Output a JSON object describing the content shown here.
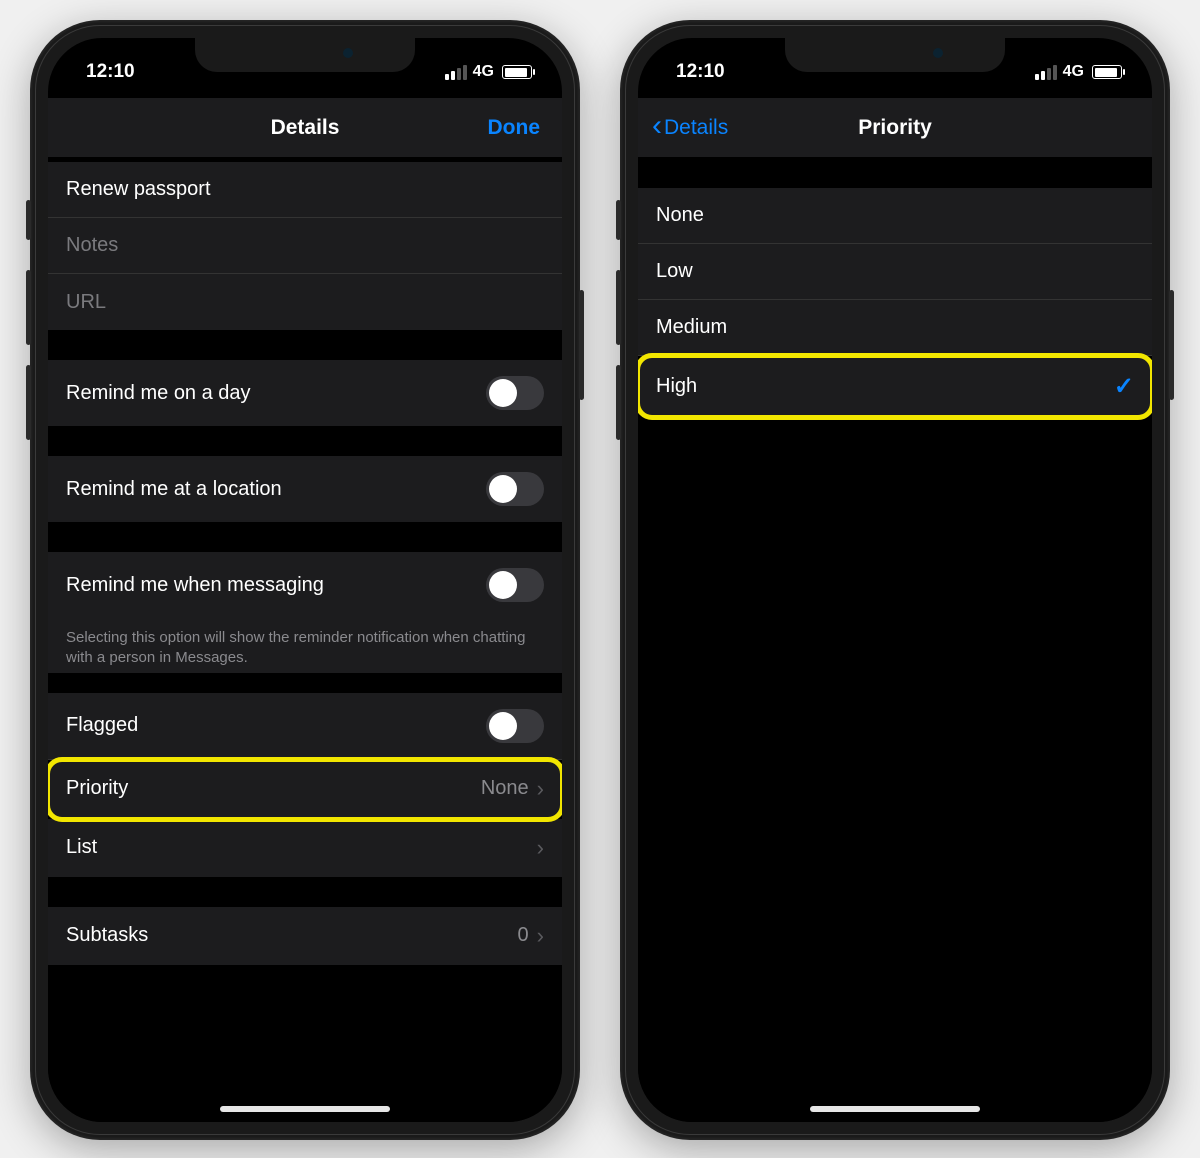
{
  "status": {
    "time": "12:10",
    "network": "4G"
  },
  "left": {
    "nav": {
      "title": "Details",
      "done": "Done"
    },
    "reminder": {
      "title": "Renew passport",
      "notes_placeholder": "Notes",
      "url_placeholder": "URL"
    },
    "rows": {
      "remind_day": "Remind me on a day",
      "remind_location": "Remind me at a location",
      "remind_messaging": "Remind me when messaging",
      "messaging_note": "Selecting this option will show the reminder notification when chatting with a person in Messages.",
      "flagged": "Flagged",
      "priority": "Priority",
      "priority_value": "None",
      "list": "List",
      "subtasks": "Subtasks",
      "subtasks_count": "0"
    }
  },
  "right": {
    "nav": {
      "back": "Details",
      "title": "Priority"
    },
    "options": [
      {
        "label": "None",
        "selected": false
      },
      {
        "label": "Low",
        "selected": false
      },
      {
        "label": "Medium",
        "selected": false
      },
      {
        "label": "High",
        "selected": true
      }
    ]
  }
}
